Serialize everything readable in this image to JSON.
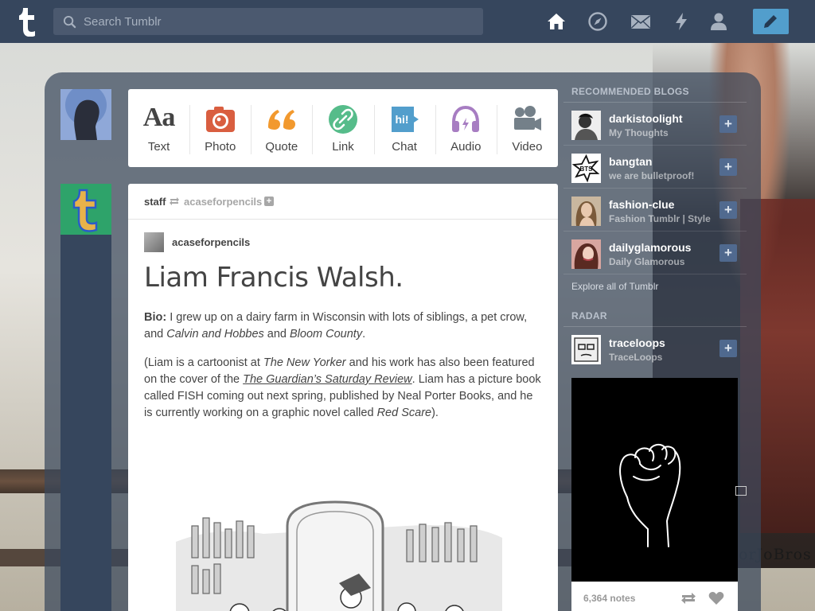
{
  "search": {
    "placeholder": "Search Tumblr"
  },
  "nav": [
    "home-icon",
    "explore-icon",
    "inbox-icon",
    "activity-icon",
    "account-icon"
  ],
  "post_types": [
    {
      "label": "Text",
      "icon": "text-icon",
      "color": "#444444"
    },
    {
      "label": "Photo",
      "icon": "camera-icon",
      "color": "#d95e40"
    },
    {
      "label": "Quote",
      "icon": "quote-icon",
      "color": "#f2992e"
    },
    {
      "label": "Link",
      "icon": "link-icon",
      "color": "#56bc8a"
    },
    {
      "label": "Chat",
      "icon": "chat-icon",
      "color": "#529ecc"
    },
    {
      "label": "Audio",
      "icon": "headphones-icon",
      "color": "#a77dc2"
    },
    {
      "label": "Video",
      "icon": "video-camera-icon",
      "color": "#748089"
    }
  ],
  "post": {
    "author": "staff",
    "reblogged_from": "acaseforpencils",
    "reblog_author": "acaseforpencils",
    "title": "Liam Francis Walsh.",
    "bio_label": "Bio:",
    "bio_text": " I grew up on a dairy farm in Wisconsin with lots of siblings, a pet crow, and ",
    "bio_em1": "Calvin and Hobbes",
    "bio_and": " and ",
    "bio_em2": "Bloom County",
    "bio_end": ".",
    "p2_a": "(Liam is a cartoonist at ",
    "p2_em1": "The New Yorker",
    "p2_b": " and his work has also been featured on the cover of the ",
    "p2_link": "The Guardian’s Saturday Review",
    "p2_c": ". Liam has a picture book called FISH coming out next spring, published by Neal Porter Books, and he is currently working on a graphic novel called ",
    "p2_em2": "Red Scare",
    "p2_d": ")."
  },
  "sidebar": {
    "recommended_heading": "RECOMMENDED BLOGS",
    "blogs": [
      {
        "name": "darkistoolight",
        "title": "My Thoughts"
      },
      {
        "name": "bangtan",
        "title": "we are bulletproof!"
      },
      {
        "name": "fashion-clue",
        "title": "Fashion Tumblr | Style"
      },
      {
        "name": "dailyglamorous",
        "title": "Daily Glamorous"
      }
    ],
    "explore_label": "Explore all of Tumblr",
    "radar_heading": "RADAR",
    "radar": {
      "name": "traceloops",
      "title": "TraceLoops",
      "notes": "6,364 notes"
    }
  },
  "background_text": "orJoBros",
  "colors": {
    "topbar": "#36465d",
    "accent": "#529ecc"
  }
}
